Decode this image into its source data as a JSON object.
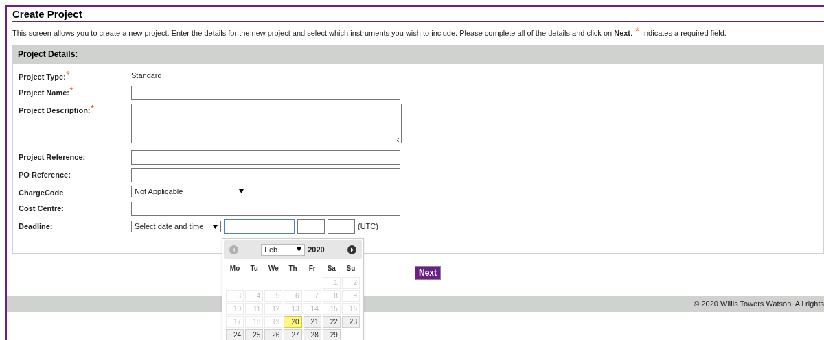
{
  "page_title": "Create Project",
  "intro": {
    "text": "This screen allows you to create a new project. Enter the details for the new project and select which instruments you wish to include. Please complete all of the details and click on **Next**.",
    "required_mark": "*",
    "required_note": "Indicates a required field."
  },
  "panel": {
    "title": "Project Details:",
    "fields": [
      {
        "kind": "static",
        "label": "Project Type:",
        "required_mark": "*",
        "value": "Standard"
      },
      {
        "kind": "text",
        "label": "Project Name:",
        "required_mark": "*"
      },
      {
        "kind": "textarea",
        "label": "Project Description:",
        "required_mark": "*"
      },
      {
        "kind": "text",
        "label": "Project Reference:"
      },
      {
        "kind": "text",
        "label": "PO Reference:"
      },
      {
        "kind": "select",
        "label": "ChargeCode",
        "value": "Not Applicable"
      },
      {
        "kind": "text",
        "label": "Cost Centre:"
      },
      {
        "kind": "datetime",
        "label": "Deadline:",
        "value": "Select date and time",
        "date_focused": true,
        "suffix": "(UTC)"
      }
    ]
  },
  "calendar": {
    "month": "Feb",
    "year": "2020",
    "prev_disabled": true,
    "next_disabled": false,
    "weekdays": [
      "Mo",
      "Tu",
      "We",
      "Th",
      "Fr",
      "Sa",
      "Su"
    ],
    "weeks": [
      [
        {
          "kind": "blank"
        },
        {
          "kind": "blank"
        },
        {
          "kind": "blank"
        },
        {
          "kind": "blank"
        },
        {
          "kind": "blank"
        },
        {
          "kind": "day",
          "label": "1",
          "disabled": true,
          "highlighted": false
        },
        {
          "kind": "day",
          "label": "2",
          "disabled": true,
          "highlighted": false
        }
      ],
      [
        {
          "kind": "day",
          "label": "3",
          "disabled": true,
          "highlighted": false
        },
        {
          "kind": "day",
          "label": "4",
          "disabled": true,
          "highlighted": false
        },
        {
          "kind": "day",
          "label": "5",
          "disabled": true,
          "highlighted": false
        },
        {
          "kind": "day",
          "label": "6",
          "disabled": true,
          "highlighted": false
        },
        {
          "kind": "day",
          "label": "7",
          "disabled": true,
          "highlighted": false
        },
        {
          "kind": "day",
          "label": "8",
          "disabled": true,
          "highlighted": false
        },
        {
          "kind": "day",
          "label": "9",
          "disabled": true,
          "highlighted": false
        }
      ],
      [
        {
          "kind": "day",
          "label": "10",
          "disabled": true,
          "highlighted": false
        },
        {
          "kind": "day",
          "label": "11",
          "disabled": true,
          "highlighted": false
        },
        {
          "kind": "day",
          "label": "12",
          "disabled": true,
          "highlighted": false
        },
        {
          "kind": "day",
          "label": "13",
          "disabled": true,
          "highlighted": false
        },
        {
          "kind": "day",
          "label": "14",
          "disabled": true,
          "highlighted": false
        },
        {
          "kind": "day",
          "label": "15",
          "disabled": true,
          "highlighted": false
        },
        {
          "kind": "day",
          "label": "16",
          "disabled": true,
          "highlighted": false
        }
      ],
      [
        {
          "kind": "day",
          "label": "17",
          "disabled": true,
          "highlighted": false
        },
        {
          "kind": "day",
          "label": "18",
          "disabled": true,
          "highlighted": false
        },
        {
          "kind": "day",
          "label": "19",
          "disabled": true,
          "highlighted": false
        },
        {
          "kind": "day",
          "label": "20",
          "disabled": false,
          "highlighted": true
        },
        {
          "kind": "day",
          "label": "21",
          "disabled": false,
          "highlighted": false
        },
        {
          "kind": "day",
          "label": "22",
          "disabled": false,
          "highlighted": false
        },
        {
          "kind": "day",
          "label": "23",
          "disabled": false,
          "highlighted": false
        }
      ],
      [
        {
          "kind": "day",
          "label": "24",
          "disabled": false,
          "highlighted": false
        },
        {
          "kind": "day",
          "label": "25",
          "disabled": false,
          "highlighted": false
        },
        {
          "kind": "day",
          "label": "26",
          "disabled": false,
          "highlighted": false
        },
        {
          "kind": "day",
          "label": "27",
          "disabled": false,
          "highlighted": false
        },
        {
          "kind": "day",
          "label": "28",
          "disabled": false,
          "highlighted": false
        },
        {
          "kind": "day",
          "label": "29",
          "disabled": false,
          "highlighted": false
        },
        {
          "kind": "blank"
        }
      ]
    ]
  },
  "next_button": "Next",
  "footer": "© 2020 Willis Towers Watson. All rights"
}
